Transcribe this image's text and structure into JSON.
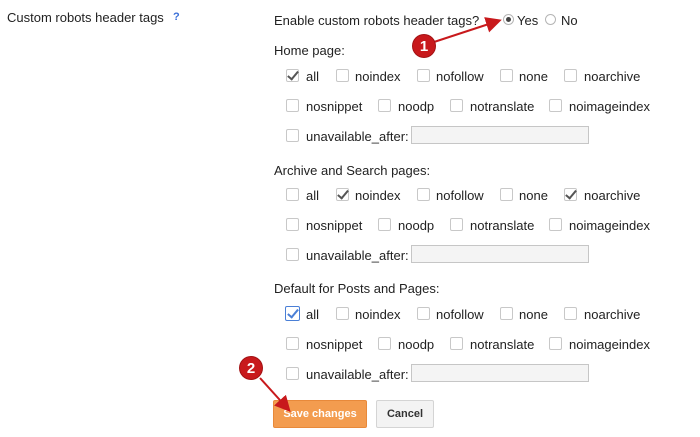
{
  "setting": {
    "label": "Custom robots header tags",
    "help": "?"
  },
  "enable": {
    "question": "Enable custom robots header tags?",
    "yes": "Yes",
    "no": "No",
    "selected": "yes"
  },
  "sections": [
    {
      "title": "Home page:",
      "row1": [
        {
          "label": "all",
          "checked": true
        },
        {
          "label": "noindex",
          "checked": false
        },
        {
          "label": "nofollow",
          "checked": false
        },
        {
          "label": "none",
          "checked": false
        },
        {
          "label": "noarchive",
          "checked": false
        }
      ],
      "row2": [
        {
          "label": "nosnippet",
          "checked": false
        },
        {
          "label": "noodp",
          "checked": false
        },
        {
          "label": "notranslate",
          "checked": false
        },
        {
          "label": "noimageindex",
          "checked": false
        }
      ],
      "unavailable": {
        "label": "unavailable_after:",
        "checked": false,
        "value": ""
      }
    },
    {
      "title": "Archive and Search pages:",
      "row1": [
        {
          "label": "all",
          "checked": false
        },
        {
          "label": "noindex",
          "checked": true
        },
        {
          "label": "nofollow",
          "checked": false
        },
        {
          "label": "none",
          "checked": false
        },
        {
          "label": "noarchive",
          "checked": true
        }
      ],
      "row2": [
        {
          "label": "nosnippet",
          "checked": false
        },
        {
          "label": "noodp",
          "checked": false
        },
        {
          "label": "notranslate",
          "checked": false
        },
        {
          "label": "noimageindex",
          "checked": false
        }
      ],
      "unavailable": {
        "label": "unavailable_after:",
        "checked": false,
        "value": ""
      }
    },
    {
      "title": "Default for Posts and Pages:",
      "row1": [
        {
          "label": "all",
          "checked": true
        },
        {
          "label": "noindex",
          "checked": false
        },
        {
          "label": "nofollow",
          "checked": false
        },
        {
          "label": "none",
          "checked": false
        },
        {
          "label": "noarchive",
          "checked": false
        }
      ],
      "row2": [
        {
          "label": "nosnippet",
          "checked": false
        },
        {
          "label": "noodp",
          "checked": false
        },
        {
          "label": "notranslate",
          "checked": false
        },
        {
          "label": "noimageindex",
          "checked": false
        }
      ],
      "unavailable": {
        "label": "unavailable_after:",
        "checked": false,
        "value": ""
      }
    }
  ],
  "buttons": {
    "save": "Save changes",
    "cancel": "Cancel"
  },
  "annotations": {
    "step1": "1",
    "step2": "2"
  },
  "colors": {
    "accent": "#f39c4f",
    "annotation": "#c8191c",
    "help": "#3a6fd8"
  }
}
